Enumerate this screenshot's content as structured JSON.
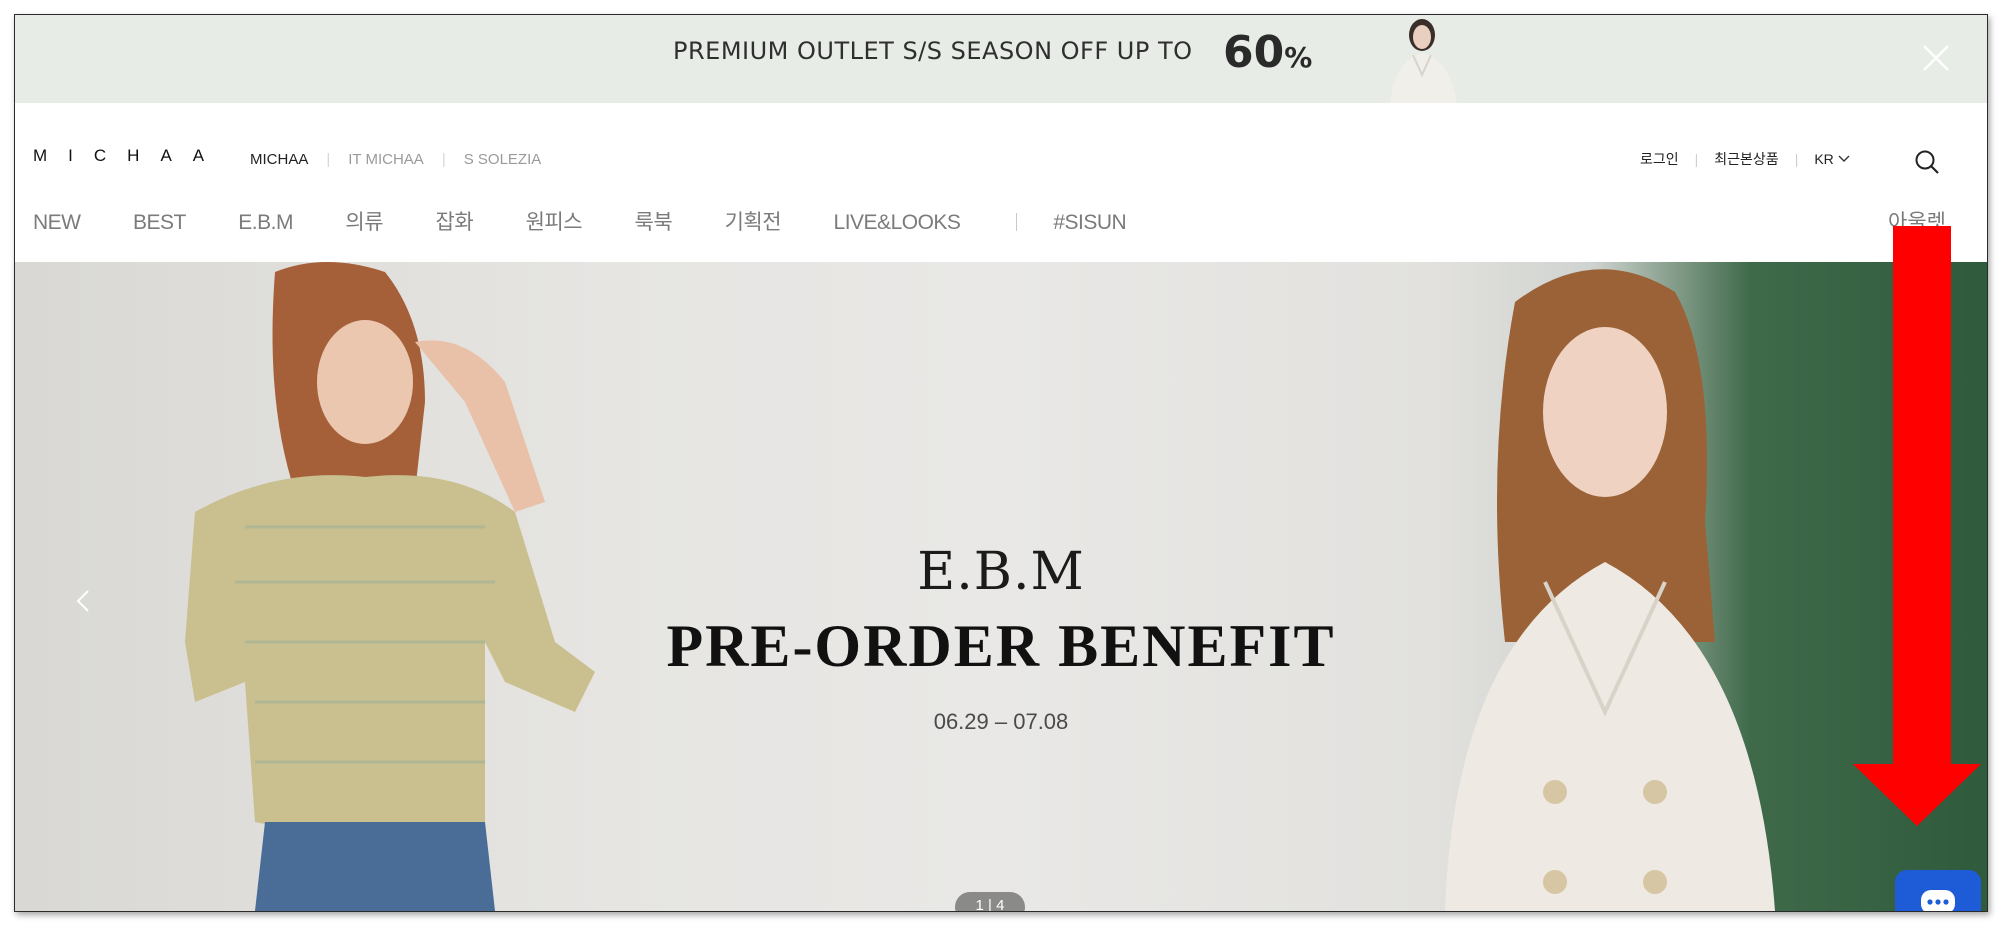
{
  "promo": {
    "text": "PREMIUM OUTLET S/S SEASON OFF UP TO",
    "discount": "60",
    "percent": "%",
    "close_label": "×"
  },
  "header": {
    "logo": "MICHAA",
    "brands": [
      "MICHAA",
      "IT MICHAA",
      "S SOLEZIA"
    ],
    "util": {
      "login": "로그인",
      "recent": "최근본상품",
      "lang": "KR"
    }
  },
  "nav": {
    "items": [
      "NEW",
      "BEST",
      "E.B.M",
      "의류",
      "잡화",
      "원피스",
      "룩북",
      "기획전",
      "LIVE&LOOKS"
    ],
    "extra": "#SISUN",
    "outlet": "아울렛"
  },
  "hero": {
    "brand": "E.B.M",
    "title": "PRE-ORDER BENEFIT",
    "date": "06.29 – 07.08",
    "pager": "1 | 4"
  },
  "colors": {
    "promo_bg": "#e7ece6",
    "arrow": "#ff0000",
    "chat": "#1e5bd6"
  }
}
